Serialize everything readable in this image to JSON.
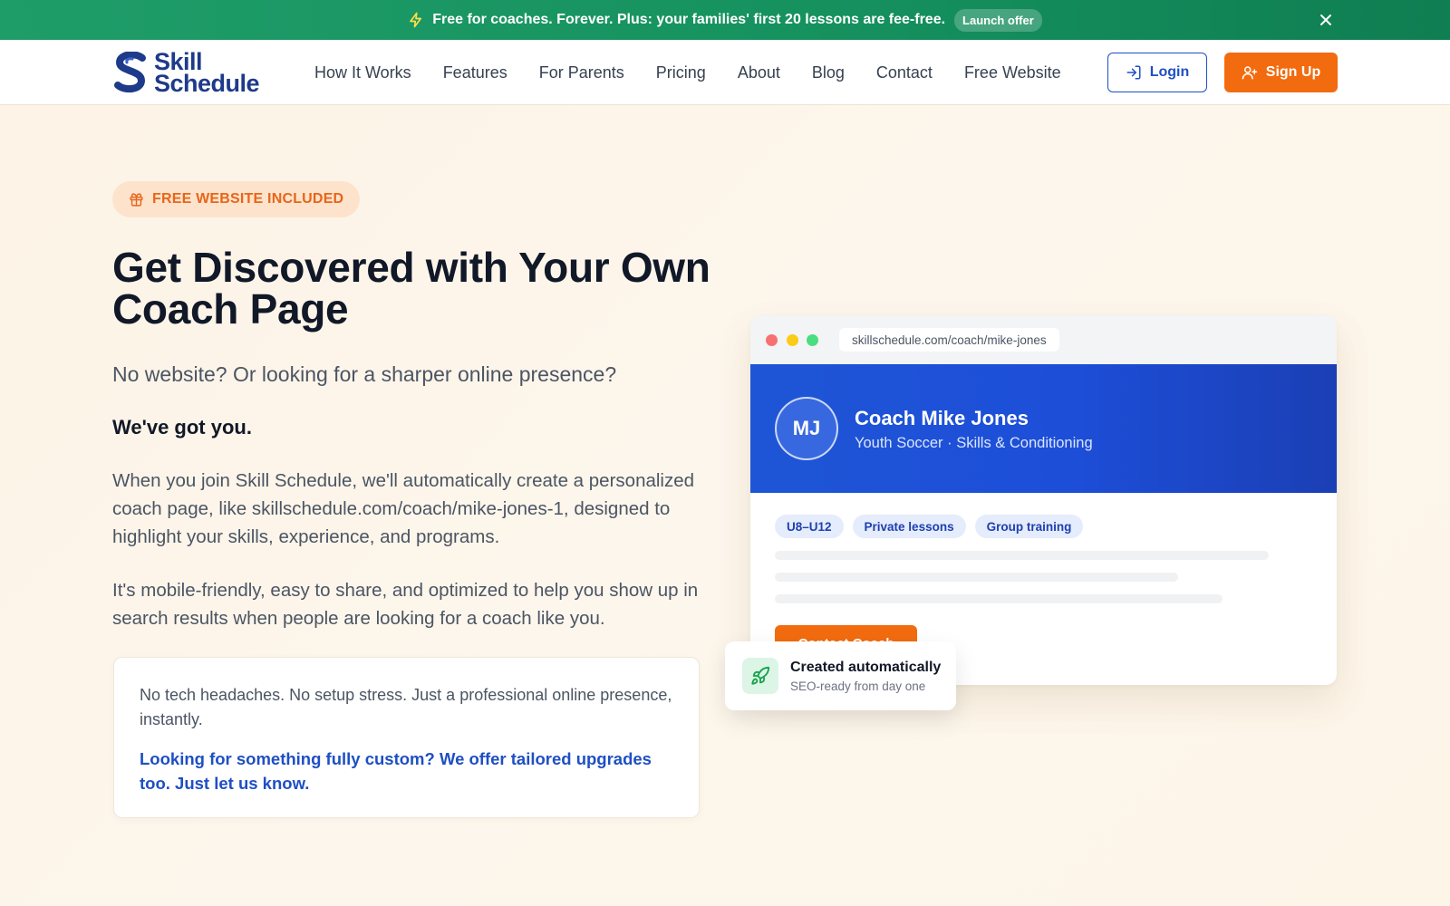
{
  "announcement": {
    "text": "Free for coaches. Forever. Plus: your families' first 20 lessons are fee-free.",
    "pill": "Launch offer",
    "icon": "lightning-icon",
    "close_icon": "close-icon",
    "colors": {
      "bg": "#1f9d69",
      "text": "#ffffff"
    }
  },
  "header": {
    "logo": {
      "line1": "Skill",
      "line2": "Schedule"
    },
    "nav": [
      "How It Works",
      "Features",
      "For Parents",
      "Pricing",
      "About",
      "Blog",
      "Contact",
      "Free Website"
    ],
    "login_label": "Login",
    "signup_label": "Sign Up",
    "colors": {
      "brand": "#1e3a8a",
      "accent": "#f26b0f",
      "link": "#1e4fc4"
    }
  },
  "hero": {
    "badge": "FREE WEBSITE INCLUDED",
    "title": "Get Discovered with Your Own Coach Page",
    "subtitle": "No website? Or looking for a sharper online presence?",
    "strong": "We've got you.",
    "para1": "When you join Skill Schedule, we'll automatically create a personalized coach page, like skillschedule.com/coach/mike-jones-1, designed to highlight your skills, experience, and programs.",
    "para2": "It's mobile-friendly, easy to share, and optimized to help you show up in search results when people are looking for a coach like you."
  },
  "infocard": {
    "text": "No tech headaches. No setup stress. Just a professional online presence, instantly.",
    "link": "Looking for something fully custom? We offer tailored upgrades too. Just let us know."
  },
  "mockup": {
    "url": "skillschedule.com/coach/mike-jones",
    "initials": "MJ",
    "name": "Coach Mike Jones",
    "subtitle": "Youth Soccer · Skills & Conditioning",
    "tags": [
      "U8–U12",
      "Private lessons",
      "Group training"
    ],
    "cta": "Contact Coach"
  },
  "toast": {
    "title": "Created automatically",
    "subtitle": "SEO-ready from day one",
    "icon": "rocket-icon"
  }
}
